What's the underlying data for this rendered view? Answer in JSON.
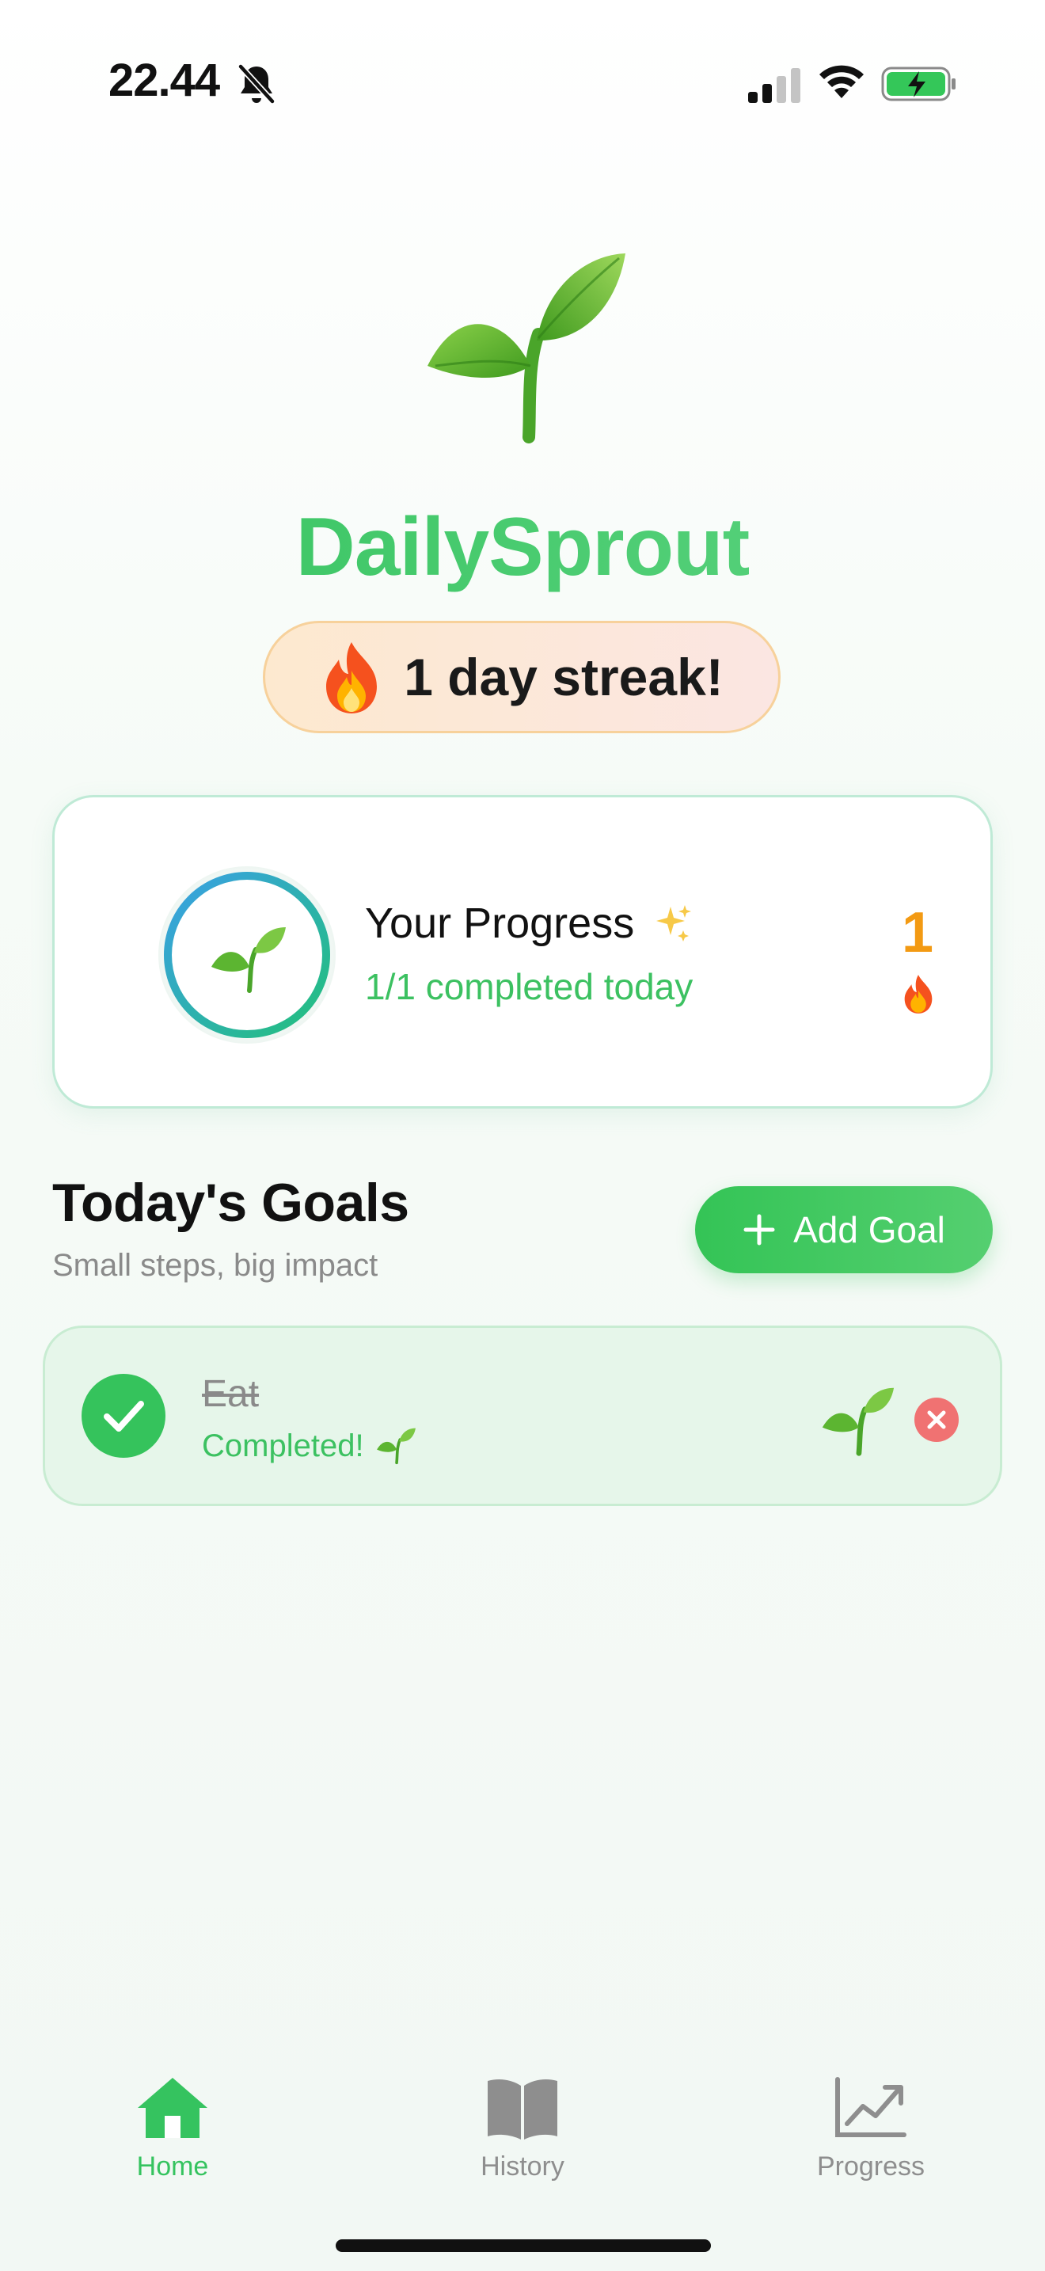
{
  "status_bar": {
    "time": "22.44",
    "icons": [
      "bell-slash-icon",
      "cellular-signal-icon",
      "wifi-icon",
      "battery-charging-icon"
    ]
  },
  "header": {
    "hero_icon": "sprout-icon",
    "app_title": "DailySprout",
    "streak": {
      "icon": "fire-icon",
      "text": "1 day streak!"
    }
  },
  "progress_card": {
    "icon": "sprout-icon",
    "title": "Your Progress",
    "title_icon": "sparkles-icon",
    "subtitle": "1/1 completed today",
    "completion_fraction": 1.0,
    "streak_count": "1",
    "streak_icon": "fire-icon"
  },
  "goals": {
    "title": "Today's Goals",
    "subtitle": "Small steps, big impact",
    "add_label": "Add Goal",
    "items": [
      {
        "name": "Eat",
        "status": "Completed!",
        "completed": true
      }
    ]
  },
  "tab_bar": {
    "tabs": [
      {
        "label": "Home",
        "icon": "house-icon",
        "active": true
      },
      {
        "label": "History",
        "icon": "book-icon",
        "active": false
      },
      {
        "label": "Progress",
        "icon": "chart-icon",
        "active": false
      }
    ]
  },
  "colors": {
    "brand_green": "#35c35f",
    "streak_orange": "#f39a13",
    "inactive_gray": "#8e8e8e",
    "delete_red": "#f07272"
  }
}
